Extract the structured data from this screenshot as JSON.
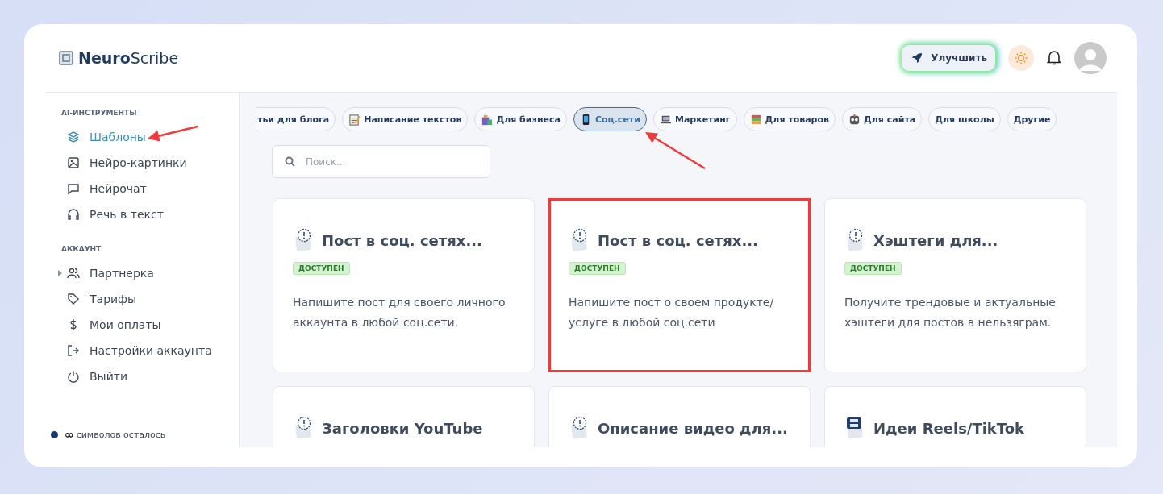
{
  "header": {
    "logo": "**Neuro**Scribe",
    "upgrade_button": "Улучшить"
  },
  "sidebar": {
    "sections": [
      {
        "heading": "AI-ИНСТРУМЕНТЫ",
        "items": [
          {
            "label": "Шаблоны",
            "selected": true,
            "has_submenu": false
          },
          {
            "label": "Нейро-картинки",
            "selected": false,
            "has_submenu": false
          },
          {
            "label": "Нейрочат",
            "selected": false,
            "has_submenu": false
          },
          {
            "label": "Речь в текст",
            "selected": false,
            "has_submenu": false
          }
        ]
      },
      {
        "heading": "АККАУНТ",
        "items": [
          {
            "label": "Партнерка",
            "selected": false,
            "has_submenu": true
          },
          {
            "label": "Тарифы",
            "selected": false,
            "has_submenu": false
          },
          {
            "label": "Мои оплаты",
            "selected": false,
            "has_submenu": false
          },
          {
            "label": "Настройки аккаунта",
            "selected": false,
            "has_submenu": false
          },
          {
            "label": "Выйти",
            "selected": false,
            "has_submenu": false
          }
        ]
      }
    ],
    "footer": {
      "count": "∞",
      "label": "символов осталось"
    }
  },
  "categories": [
    {
      "label": "тьи для блога",
      "selected": false
    },
    {
      "label": "Написание текстов",
      "selected": false
    },
    {
      "label": "Для бизнеса",
      "selected": false
    },
    {
      "label": "Соц.сети",
      "selected": true
    },
    {
      "label": "Маркетинг",
      "selected": false
    },
    {
      "label": "Для товаров",
      "selected": false
    },
    {
      "label": "Для сайта",
      "selected": false
    },
    {
      "label": "Для школы",
      "selected": false
    },
    {
      "label": "Другие",
      "selected": false
    }
  ],
  "search": {
    "placeholder": "Поиск..."
  },
  "cards": [
    {
      "title": "Пост в соц. сетях...",
      "badge": "ДОСТУПЕН",
      "description": "Напишите пост для своего личного аккаунта в любой соц.сети.",
      "highlighted": false
    },
    {
      "title": "Пост в соц. сетях...",
      "badge": "ДОСТУПЕН",
      "description": "Напишите пост о своем продукте/ услуге в любой соц.сети",
      "highlighted": true
    },
    {
      "title": "Хэштеги для...",
      "badge": "ДОСТУПЕН",
      "description": "Получите трендовые и актуальные хэштеги для постов в нельзяграм.",
      "highlighted": false
    },
    {
      "title": "Заголовки YouTube",
      "highlighted": false
    },
    {
      "title": "Описание видео для...",
      "highlighted": false
    },
    {
      "title": "Идеи Reels/TikTok",
      "highlighted": false
    }
  ]
}
